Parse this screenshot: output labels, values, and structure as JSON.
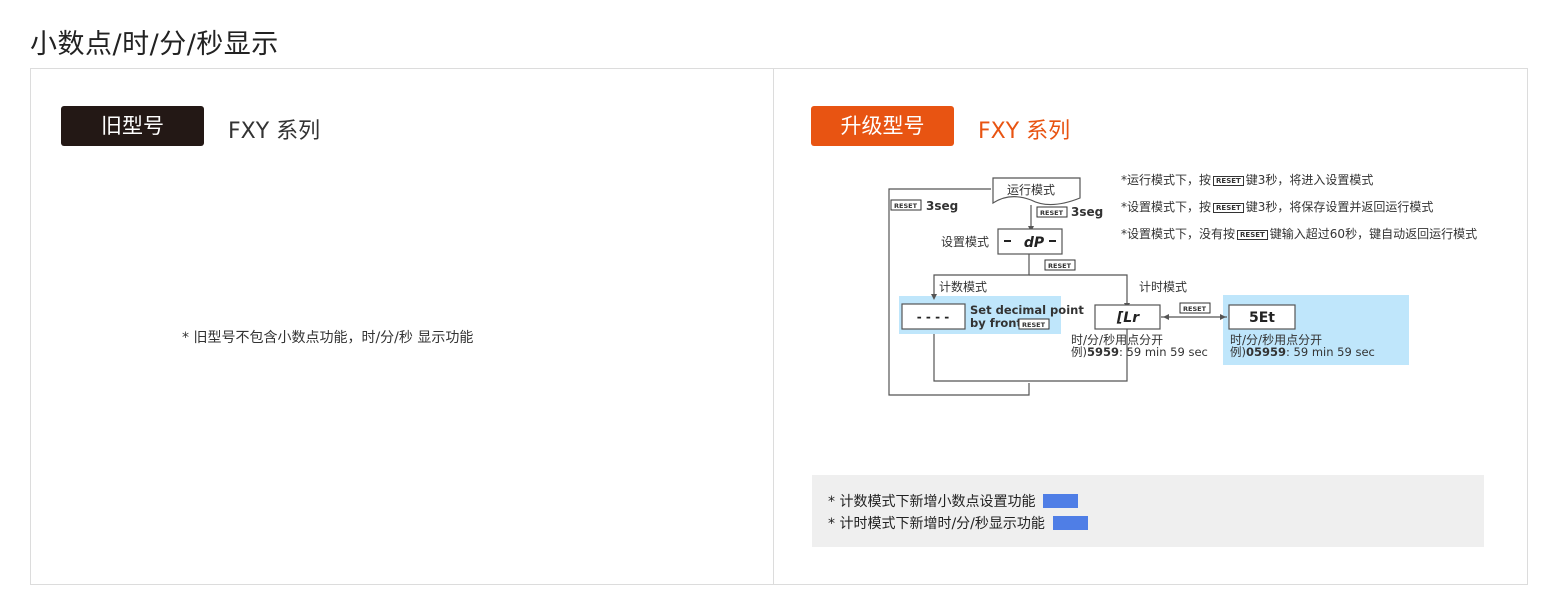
{
  "page": {
    "title": "小数点/时/分/秒显示"
  },
  "old_model": {
    "badge": "旧型号",
    "series": "FXY 系列",
    "note": "* 旧型号不包含小数点功能，时/分/秒 显示功能"
  },
  "new_model": {
    "badge": "升级型号",
    "series": "FXY 系列",
    "flow": {
      "run_mode": "运行模式",
      "setting_mode": "设置模式",
      "count_mode": "计数模式",
      "timer_mode": "计时模式",
      "reset_key": "RESET",
      "hold_3seg": "3seg",
      "display_dp": "dP",
      "display_dashes": "- - - -",
      "display_clr": "[Lr",
      "display_set": "5Et",
      "decimal_line1": "Set decimal point",
      "decimal_line2": "by front",
      "clr_caption1": "时/分/秒用点分开",
      "clr_caption2_prefix": "例)",
      "clr_caption2_value": "5959",
      "clr_caption2_suffix": ": 59 min 59 sec",
      "set_caption1": "时/分/秒用点分开",
      "set_caption2_prefix": "例)",
      "set_caption2_value": "05959",
      "set_caption2_suffix": ": 59 min 59 sec"
    },
    "notes": [
      {
        "prefix": "*运行模式下，按",
        "suffix": "键3秒，将进入设置模式"
      },
      {
        "prefix": "*设置模式下，按",
        "suffix": "键3秒，将保存设置并返回运行模式"
      },
      {
        "prefix": "*设置模式下，没有按",
        "suffix": "键输入超过60秒，键自动返回运行模式"
      }
    ],
    "summary": [
      "* 计数模式下新增小数点设置功能",
      "* 计时模式下新增时/分/秒显示功能"
    ]
  },
  "colors": {
    "old_badge": "#231815",
    "new_badge": "#e85412",
    "highlight": "#bfe6fb",
    "swatch": "#4f7ee6"
  }
}
